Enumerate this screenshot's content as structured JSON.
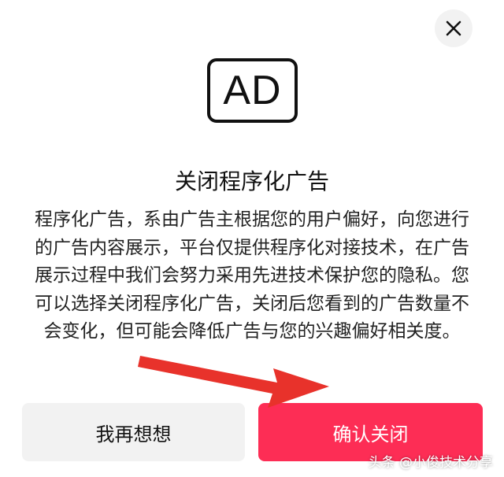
{
  "dialog": {
    "close_icon": "close-icon",
    "ad_badge_text": "AD",
    "title": "关闭程序化广告",
    "description": "程序化广告，系由广告主根据您的用户偏好，向您进行的广告内容展示，平台仅提供程序化对接技术，在广告展示过程中我们会努力采用先进技术保护您的隐私。您可以选择关闭程序化广告，关闭后您看到的广告数量不会变化，但可能会降低广告与您的兴趣偏好相关度。",
    "secondary_button_label": "我再想想",
    "primary_button_label": "确认关闭"
  },
  "annotation": {
    "arrow_icon": "red-arrow-icon"
  },
  "watermark": {
    "text": "头条 @小俊技术分享"
  },
  "colors": {
    "primary": "#fd2d55",
    "secondary_bg": "#f2f2f2",
    "arrow": "#e8322b"
  }
}
